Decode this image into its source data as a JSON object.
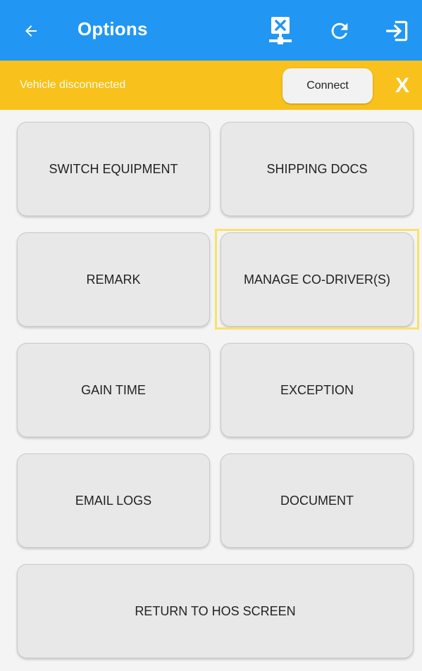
{
  "appbar": {
    "title": "Options",
    "icons": [
      "back-arrow-icon",
      "disconnect-network-icon",
      "refresh-icon",
      "logout-icon"
    ],
    "color": "#2196f3"
  },
  "banner": {
    "message": "Vehicle disconnected",
    "connect_label": "Connect",
    "close_label": "X",
    "color": "#f8c11b"
  },
  "options": [
    {
      "label": "SWITCH EQUIPMENT"
    },
    {
      "label": "SHIPPING DOCS"
    },
    {
      "label": "REMARK"
    },
    {
      "label": "MANAGE CO-DRIVER(S)",
      "focused": true
    },
    {
      "label": "GAIN TIME"
    },
    {
      "label": "EXCEPTION"
    },
    {
      "label": "EMAIL LOGS"
    },
    {
      "label": "DOCUMENT"
    },
    {
      "label": "RETURN TO HOS SCREEN"
    }
  ]
}
